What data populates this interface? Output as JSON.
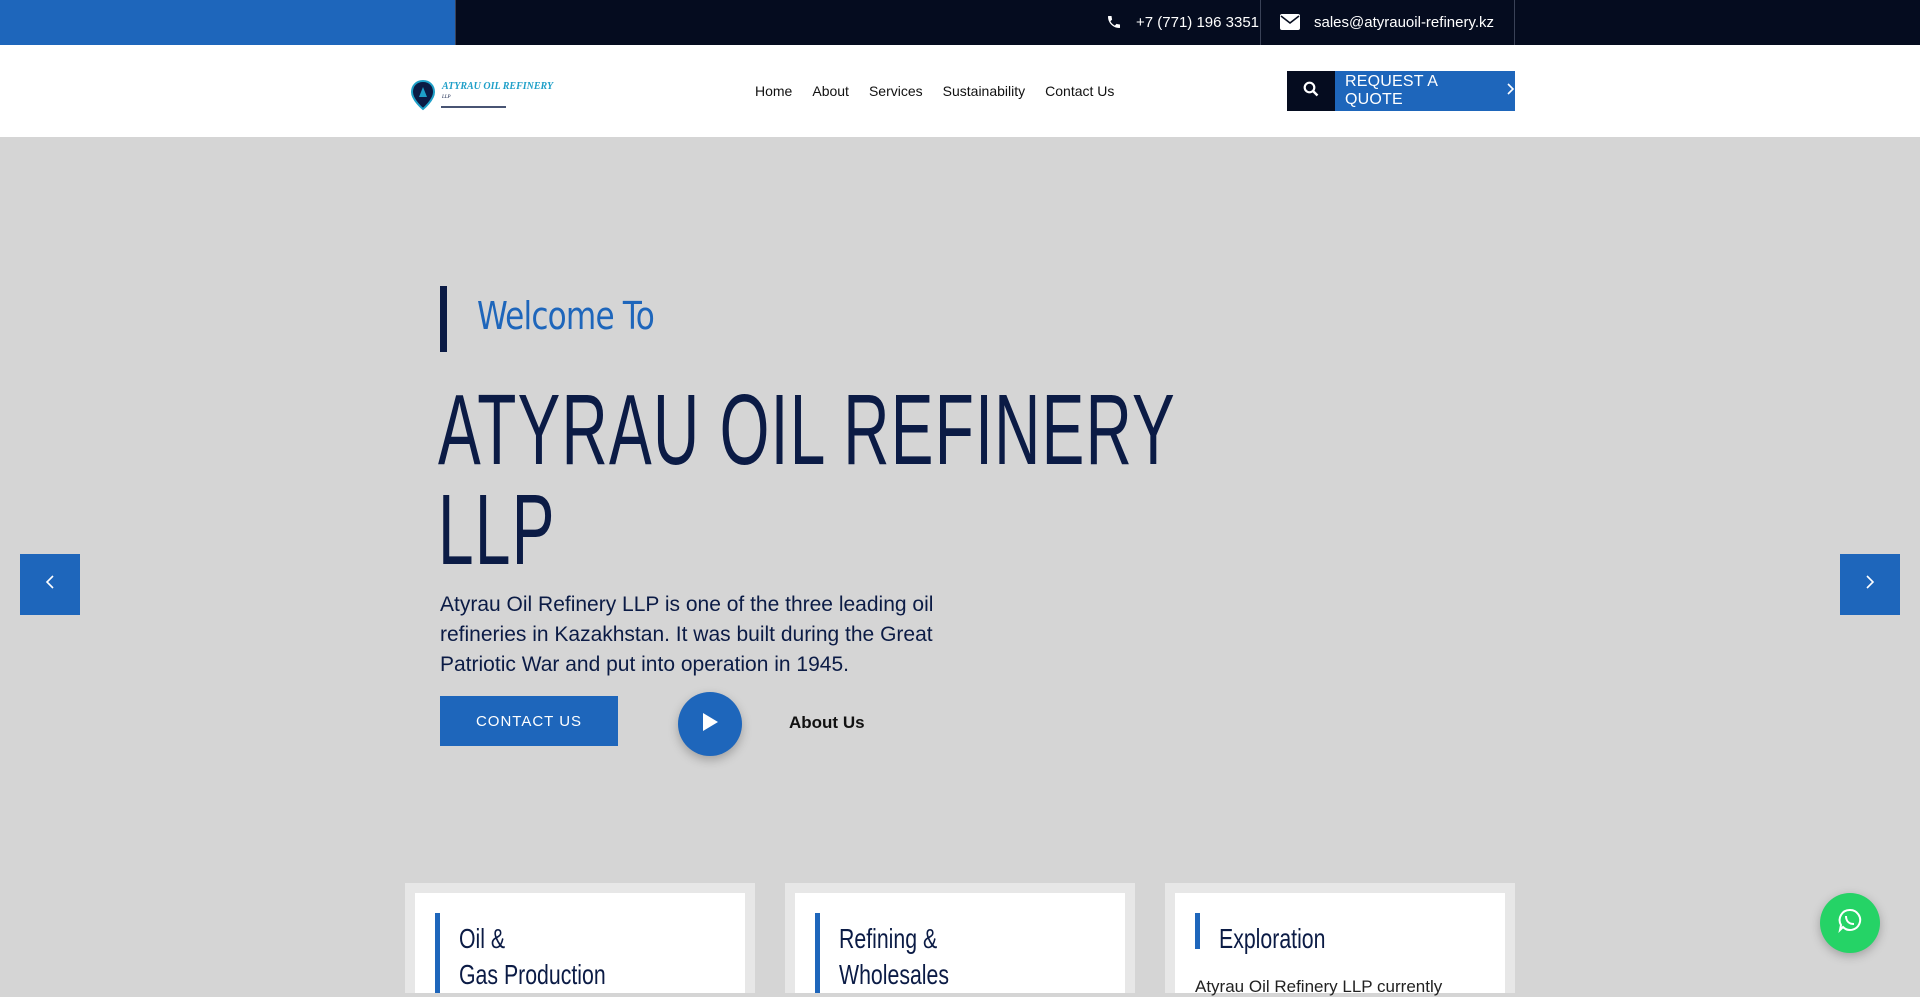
{
  "topbar": {
    "phone": "+7 (771) 196 3351",
    "email": "sales@atyrauoil-refinery.kz"
  },
  "logo": {
    "name": "ATYRAU OIL REFINERY",
    "sub": "LLP"
  },
  "nav": {
    "items": [
      {
        "label": "Home"
      },
      {
        "label": "About"
      },
      {
        "label": "Services"
      },
      {
        "label": "Sustainability"
      },
      {
        "label": "Contact Us"
      }
    ]
  },
  "header": {
    "quote_label": "REQUEST A QUOTE",
    "search_icon": "search-icon"
  },
  "hero": {
    "welcome": "Welcome To",
    "title_line1": "ATYRAU OIL REFINERY",
    "title_line2": "LLP",
    "description": "Atyrau Oil Refinery LLP is one of the three leading oil refineries in Kazakhstan. It was built during the Great Patriotic War and put into operation in 1945.",
    "contact_label": "CONTACT US",
    "about_label": "About Us"
  },
  "cards": [
    {
      "title_line1": "Oil &",
      "title_line2": "Gas Production",
      "text": ""
    },
    {
      "title_line1": "Refining &",
      "title_line2": "Wholesales",
      "text": ""
    },
    {
      "title_line1": "Exploration",
      "title_line2": "",
      "text": "Atyrau Oil Refinery LLP currently"
    }
  ],
  "colors": {
    "accent": "#1e66bb",
    "dark": "#050c1f",
    "navy_text": "#0b1b45",
    "hero_bg": "#d5d5d5",
    "whatsapp": "#25d366"
  }
}
